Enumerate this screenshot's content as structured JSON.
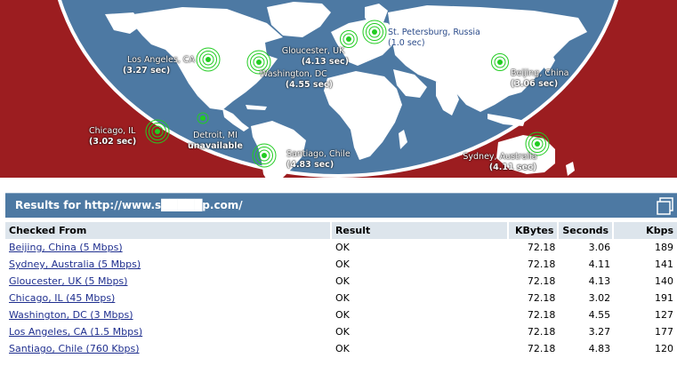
{
  "map": {
    "cities": [
      {
        "id": "st-petersburg",
        "name": "St. Petersburg, Russia",
        "time": "(1.0 sec)"
      },
      {
        "id": "gloucester",
        "name": "Gloucester, UK",
        "time": "(4.13 sec)"
      },
      {
        "id": "los-angeles",
        "name": "Los Angeles, CA",
        "time": "(3.27 sec)"
      },
      {
        "id": "washington",
        "name": "Washington, DC",
        "time": "(4.55 sec)"
      },
      {
        "id": "beijing",
        "name": "Beijing, China",
        "time": "(3.06 sec)"
      },
      {
        "id": "chicago",
        "name": "Chicago, IL",
        "time": "(3.02 sec)"
      },
      {
        "id": "detroit",
        "name": "Detroit, MI",
        "time": "unavailable"
      },
      {
        "id": "santiago",
        "name": "Santiago, Chile",
        "time": "(4.83 sec)"
      },
      {
        "id": "sydney",
        "name": "Sydney, Australia",
        "time": "(4.11 sec)"
      }
    ]
  },
  "results": {
    "title": "Results for http://www.s█████p.com/",
    "columns": [
      "Checked From",
      "Result",
      "KBytes",
      "Seconds",
      "Kbps"
    ],
    "rows": [
      {
        "from": "Beijing, China (5 Mbps)",
        "result": "OK",
        "kbytes": "72.18",
        "seconds": "3.06",
        "kbps": "189"
      },
      {
        "from": "Sydney, Australia (5 Mbps)",
        "result": "OK",
        "kbytes": "72.18",
        "seconds": "4.11",
        "kbps": "141"
      },
      {
        "from": "Gloucester, UK (5 Mbps)",
        "result": "OK",
        "kbytes": "72.18",
        "seconds": "4.13",
        "kbps": "140"
      },
      {
        "from": "Chicago, IL (45 Mbps)",
        "result": "OK",
        "kbytes": "72.18",
        "seconds": "3.02",
        "kbps": "191"
      },
      {
        "from": "Washington, DC (3 Mbps)",
        "result": "OK",
        "kbytes": "72.18",
        "seconds": "4.55",
        "kbps": "127"
      },
      {
        "from": "Los Angeles, CA (1.5 Mbps)",
        "result": "OK",
        "kbytes": "72.18",
        "seconds": "3.27",
        "kbps": "177"
      },
      {
        "from": "Santiago, Chile (760 Kbps)",
        "result": "OK",
        "kbytes": "72.18",
        "seconds": "4.83",
        "kbps": "120"
      }
    ]
  },
  "colors": {
    "frame": "#9c1d20",
    "ocean": "#4d79a3",
    "header": "#4d79a3",
    "column_header": "#dde5ec",
    "link": "#1f2f8f",
    "pin": "#22cc22"
  },
  "icons": {
    "pin": "location-pulse-icon",
    "expand": "expand-window-icon"
  }
}
